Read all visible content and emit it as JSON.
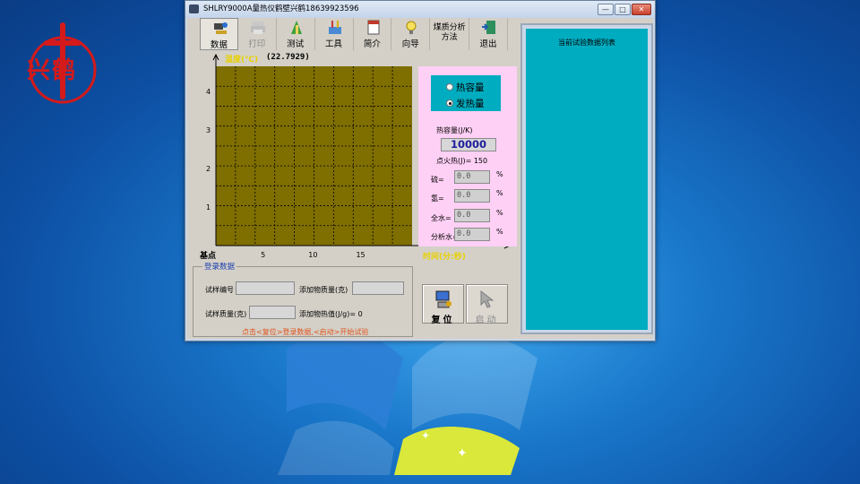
{
  "window": {
    "title": "SHLRY9000A量热仪鹤壁兴鹤18639923596",
    "controls": {
      "minimize": "—",
      "maximize": "□",
      "close": "✕"
    }
  },
  "toolbar": {
    "items": [
      {
        "label": "数据",
        "icon": "data-icon",
        "selected": true,
        "enabled": true
      },
      {
        "label": "打印",
        "icon": "printer-icon",
        "enabled": false
      },
      {
        "label": "测试",
        "icon": "test-icon",
        "enabled": true
      },
      {
        "label": "工具",
        "icon": "tools-icon",
        "enabled": true
      },
      {
        "label": "简介",
        "icon": "notebook-icon",
        "enabled": true
      },
      {
        "label": "向导",
        "icon": "lightbulb-icon",
        "enabled": true
      },
      {
        "label": "煤质分析\n方法",
        "icon": "",
        "enabled": true
      },
      {
        "label": "退出",
        "icon": "exit-door-icon",
        "enabled": true
      }
    ]
  },
  "chart": {
    "y_title": "温度(℃)",
    "y_value": "(22.7929)",
    "origin_label": "基点",
    "x_title": "时间(分:秒)",
    "colors": {
      "plot_bg": "#7f6e00",
      "grid": "#000000",
      "axis_title": "#e8d100"
    }
  },
  "chart_data": {
    "type": "line",
    "title": "",
    "xlabel": "时间(分:秒)",
    "ylabel": "温度(℃)",
    "x_ticks": [
      "5",
      "10",
      "15"
    ],
    "y_ticks": [
      "1",
      "2",
      "3",
      "4"
    ],
    "series": [],
    "grid": true
  },
  "settings": {
    "mode_options": [
      "热容量",
      "发热量"
    ],
    "selected_mode": "发热量",
    "heat_capacity_label": "热容量(J/K)",
    "heat_capacity_value": "10000",
    "ignition_heat_label": "点火热(J)= 150",
    "fields": [
      {
        "label": "硫=",
        "value": "0.0",
        "unit": "%"
      },
      {
        "label": "氢=",
        "value": "0.0",
        "unit": "%"
      },
      {
        "label": "全水=",
        "value": "0.0",
        "unit": "%"
      },
      {
        "label": "分析水=",
        "value": "0.0",
        "unit": "%"
      }
    ]
  },
  "record": {
    "legend": "登录数据",
    "sample_no_label": "试样编号",
    "additive_mass_label": "添加物质量(克)",
    "sample_mass_label": "试样质量(克)",
    "additive_heat_label": "添加物热值(J/g)= 0",
    "hint": "点击<复位>登录数据,<启动>开始试验"
  },
  "buttons": {
    "reset": {
      "label": "复位",
      "icon": "computer-reset-icon"
    },
    "start": {
      "label": "启动",
      "icon": "cursor-arrow-icon",
      "enabled": false
    }
  },
  "list_panel": {
    "title": "当前试验数据列表"
  },
  "desktop": {
    "logo_caption": "兴鹤"
  }
}
